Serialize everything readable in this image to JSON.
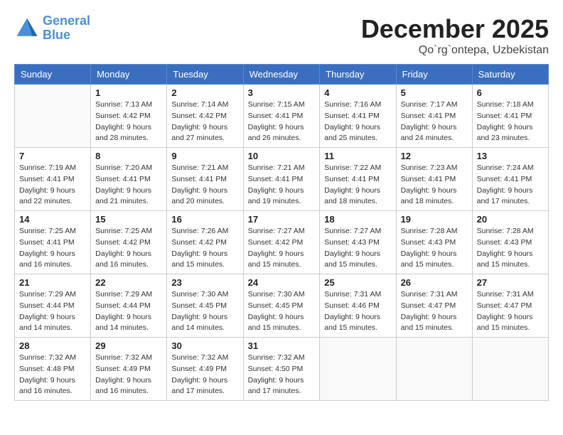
{
  "header": {
    "logo_line1": "General",
    "logo_line2": "Blue",
    "month": "December 2025",
    "location": "Qo`rg`ontepa, Uzbekistan"
  },
  "weekdays": [
    "Sunday",
    "Monday",
    "Tuesday",
    "Wednesday",
    "Thursday",
    "Friday",
    "Saturday"
  ],
  "weeks": [
    [
      {
        "day": null
      },
      {
        "day": 1,
        "sunrise": "7:13 AM",
        "sunset": "4:42 PM",
        "daylight": "9 hours and 28 minutes."
      },
      {
        "day": 2,
        "sunrise": "7:14 AM",
        "sunset": "4:42 PM",
        "daylight": "9 hours and 27 minutes."
      },
      {
        "day": 3,
        "sunrise": "7:15 AM",
        "sunset": "4:41 PM",
        "daylight": "9 hours and 26 minutes."
      },
      {
        "day": 4,
        "sunrise": "7:16 AM",
        "sunset": "4:41 PM",
        "daylight": "9 hours and 25 minutes."
      },
      {
        "day": 5,
        "sunrise": "7:17 AM",
        "sunset": "4:41 PM",
        "daylight": "9 hours and 24 minutes."
      },
      {
        "day": 6,
        "sunrise": "7:18 AM",
        "sunset": "4:41 PM",
        "daylight": "9 hours and 23 minutes."
      }
    ],
    [
      {
        "day": 7,
        "sunrise": "7:19 AM",
        "sunset": "4:41 PM",
        "daylight": "9 hours and 22 minutes."
      },
      {
        "day": 8,
        "sunrise": "7:20 AM",
        "sunset": "4:41 PM",
        "daylight": "9 hours and 21 minutes."
      },
      {
        "day": 9,
        "sunrise": "7:21 AM",
        "sunset": "4:41 PM",
        "daylight": "9 hours and 20 minutes."
      },
      {
        "day": 10,
        "sunrise": "7:21 AM",
        "sunset": "4:41 PM",
        "daylight": "9 hours and 19 minutes."
      },
      {
        "day": 11,
        "sunrise": "7:22 AM",
        "sunset": "4:41 PM",
        "daylight": "9 hours and 18 minutes."
      },
      {
        "day": 12,
        "sunrise": "7:23 AM",
        "sunset": "4:41 PM",
        "daylight": "9 hours and 18 minutes."
      },
      {
        "day": 13,
        "sunrise": "7:24 AM",
        "sunset": "4:41 PM",
        "daylight": "9 hours and 17 minutes."
      }
    ],
    [
      {
        "day": 14,
        "sunrise": "7:25 AM",
        "sunset": "4:41 PM",
        "daylight": "9 hours and 16 minutes."
      },
      {
        "day": 15,
        "sunrise": "7:25 AM",
        "sunset": "4:42 PM",
        "daylight": "9 hours and 16 minutes."
      },
      {
        "day": 16,
        "sunrise": "7:26 AM",
        "sunset": "4:42 PM",
        "daylight": "9 hours and 15 minutes."
      },
      {
        "day": 17,
        "sunrise": "7:27 AM",
        "sunset": "4:42 PM",
        "daylight": "9 hours and 15 minutes."
      },
      {
        "day": 18,
        "sunrise": "7:27 AM",
        "sunset": "4:43 PM",
        "daylight": "9 hours and 15 minutes."
      },
      {
        "day": 19,
        "sunrise": "7:28 AM",
        "sunset": "4:43 PM",
        "daylight": "9 hours and 15 minutes."
      },
      {
        "day": 20,
        "sunrise": "7:28 AM",
        "sunset": "4:43 PM",
        "daylight": "9 hours and 15 minutes."
      }
    ],
    [
      {
        "day": 21,
        "sunrise": "7:29 AM",
        "sunset": "4:44 PM",
        "daylight": "9 hours and 14 minutes."
      },
      {
        "day": 22,
        "sunrise": "7:29 AM",
        "sunset": "4:44 PM",
        "daylight": "9 hours and 14 minutes."
      },
      {
        "day": 23,
        "sunrise": "7:30 AM",
        "sunset": "4:45 PM",
        "daylight": "9 hours and 14 minutes."
      },
      {
        "day": 24,
        "sunrise": "7:30 AM",
        "sunset": "4:45 PM",
        "daylight": "9 hours and 15 minutes."
      },
      {
        "day": 25,
        "sunrise": "7:31 AM",
        "sunset": "4:46 PM",
        "daylight": "9 hours and 15 minutes."
      },
      {
        "day": 26,
        "sunrise": "7:31 AM",
        "sunset": "4:47 PM",
        "daylight": "9 hours and 15 minutes."
      },
      {
        "day": 27,
        "sunrise": "7:31 AM",
        "sunset": "4:47 PM",
        "daylight": "9 hours and 15 minutes."
      }
    ],
    [
      {
        "day": 28,
        "sunrise": "7:32 AM",
        "sunset": "4:48 PM",
        "daylight": "9 hours and 16 minutes."
      },
      {
        "day": 29,
        "sunrise": "7:32 AM",
        "sunset": "4:49 PM",
        "daylight": "9 hours and 16 minutes."
      },
      {
        "day": 30,
        "sunrise": "7:32 AM",
        "sunset": "4:49 PM",
        "daylight": "9 hours and 17 minutes."
      },
      {
        "day": 31,
        "sunrise": "7:32 AM",
        "sunset": "4:50 PM",
        "daylight": "9 hours and 17 minutes."
      },
      {
        "day": null
      },
      {
        "day": null
      },
      {
        "day": null
      }
    ]
  ]
}
